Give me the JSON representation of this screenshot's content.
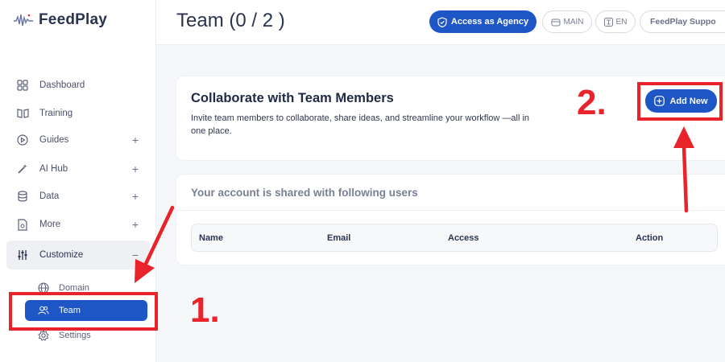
{
  "brand": {
    "name": "FeedPlay"
  },
  "header": {
    "title": "Team (0 / 2  )",
    "agency_button": "Access as Agency",
    "main_pill": "MAIN",
    "lang_pill": "EN",
    "support_pill": "FeedPlay Suppo"
  },
  "sidebar": {
    "items": [
      {
        "label": "Dashboard",
        "icon": "dashboard-icon"
      },
      {
        "label": "Training",
        "icon": "book-icon"
      },
      {
        "label": "Guides",
        "icon": "play-circle-icon",
        "expandable": true
      },
      {
        "label": "AI Hub",
        "icon": "magic-wand-icon",
        "expandable": true
      },
      {
        "label": "Data",
        "icon": "database-icon",
        "expandable": true
      },
      {
        "label": "More",
        "icon": "document-icon",
        "expandable": true
      },
      {
        "label": "Customize",
        "icon": "sliders-icon",
        "expanded": true
      }
    ],
    "subitems": [
      {
        "label": "Domain",
        "icon": "globe-icon"
      },
      {
        "label": "Team",
        "icon": "users-icon",
        "active": true
      },
      {
        "label": "Settings",
        "icon": "gear-icon"
      }
    ],
    "expand_symbol": "+",
    "collapse_symbol": "−"
  },
  "collab": {
    "title": "Collaborate with Team Members",
    "description": "Invite team members to collaborate, share ideas, and streamline your workflow —all in one place.",
    "add_button": "Add New"
  },
  "shared": {
    "title": "Your account is shared with following users",
    "columns": [
      "Name",
      "Email",
      "Access",
      "Action"
    ]
  },
  "annotations": {
    "step1": "1.",
    "step2": "2."
  },
  "colors": {
    "accent": "#1e56c6",
    "annotation": "#e8242a"
  }
}
